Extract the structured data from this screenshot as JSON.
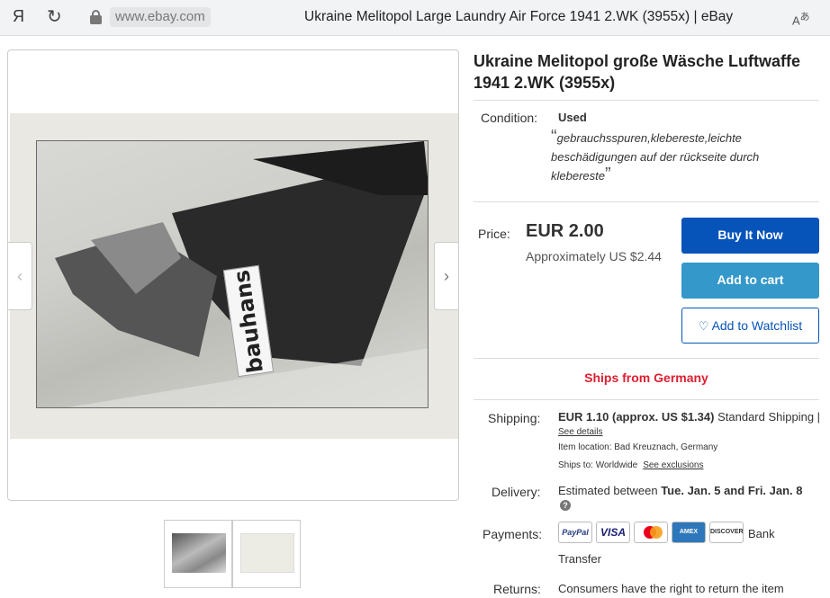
{
  "browser": {
    "logo": "Я",
    "domain": "www.ebay.com",
    "tab_title": "Ukraine Melitopol Large Laundry Air Force 1941 2.WK (3955x) | eBay",
    "translate_icon": "translate-icon"
  },
  "gallery": {
    "photo_text": "bauhans",
    "prev_arrow": "‹",
    "next_arrow": "›"
  },
  "product": {
    "title": "Ukraine Melitopol große Wäsche Luftwaffe 1941 2.WK (3955x)",
    "condition_label": "Condition:",
    "condition_value": "Used",
    "condition_desc": "gebrauchsspuren,klebereste,leichte beschädigungen auf der rückseite durch klebereste",
    "price_label": "Price:",
    "price": "EUR 2.00",
    "approx_price": "Approximately US $2.44",
    "buy_now": "Buy It Now",
    "add_to_cart": "Add to cart",
    "watchlist": "Add to Watchlist",
    "ships_from": "Ships from Germany"
  },
  "shipping": {
    "label": "Shipping:",
    "cost": "EUR 1.10",
    "approx": "(approx.",
    "approx_usd": "US $1.34)",
    "service": "Standard Shipping |",
    "see_details": "See details",
    "item_location": "Item location:  Bad Kreuznach, Germany",
    "ships_to_label": "Ships to:  Worldwide",
    "see_exclusions": "See exclusions"
  },
  "delivery": {
    "label": "Delivery:",
    "text_prefix": "Estimated between",
    "date_start": "Tue. Jan. 5",
    "and": "and",
    "date_end": "Fri. Jan. 8"
  },
  "payments": {
    "label": "Payments:",
    "cards": [
      "PayPal",
      "VISA",
      "MasterCard",
      "AMERICAN EXPRESS",
      "DISCOVER"
    ],
    "bank": "Bank",
    "transfer": "Transfer"
  },
  "returns": {
    "label": "Returns:",
    "text": "Consumers have the right to return the item"
  },
  "colors": {
    "buy_now": "#0654ba",
    "add_to_cart": "#3498ca",
    "ships_from": "#dd1e31"
  }
}
